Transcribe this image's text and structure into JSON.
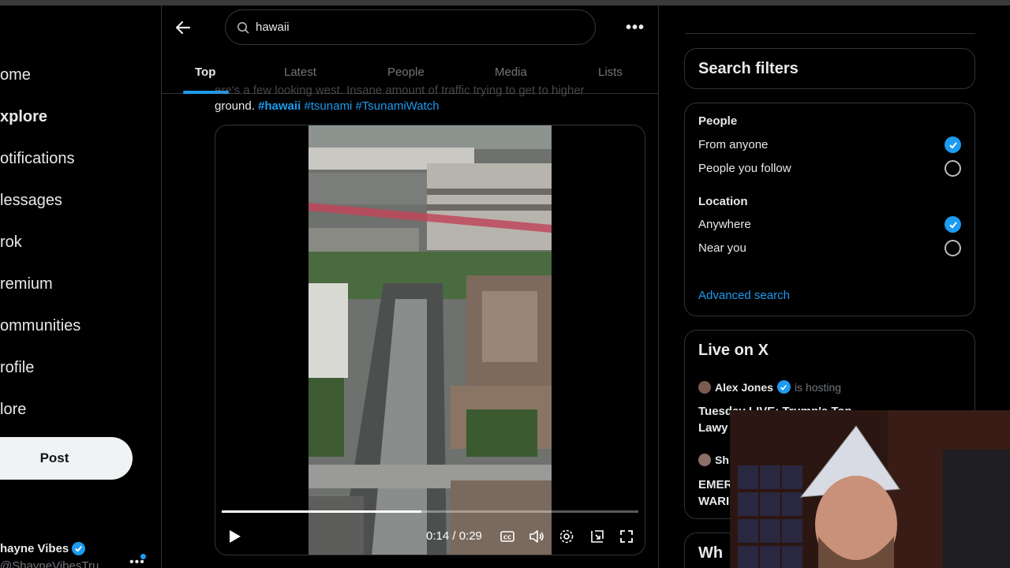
{
  "nav": {
    "items": [
      {
        "key": "home",
        "label": "ome"
      },
      {
        "key": "explore",
        "label": "xplore"
      },
      {
        "key": "notifications",
        "label": "otifications"
      },
      {
        "key": "messages",
        "label": "lessages"
      },
      {
        "key": "grok",
        "label": "rok"
      },
      {
        "key": "premium",
        "label": "remium"
      },
      {
        "key": "communities",
        "label": "ommunities"
      },
      {
        "key": "profile",
        "label": "rofile"
      },
      {
        "key": "more",
        "label": "lore"
      }
    ],
    "post_label": "Post",
    "account_name": "hayne Vibes",
    "account_handle": "@ShayneVibesTru"
  },
  "search": {
    "value": "hawaii"
  },
  "tabs": [
    {
      "label": "Top"
    },
    {
      "label": "Latest"
    },
    {
      "label": "People"
    },
    {
      "label": "Media"
    },
    {
      "label": "Lists"
    }
  ],
  "tweet": {
    "faded_text": "ere's a few looking west. Insane amount of traffic trying to get to higher",
    "text_prefix": "ground. ",
    "hashtags": [
      "#hawaii",
      "#tsunami",
      "#TsunamiWatch"
    ]
  },
  "video": {
    "time": "0:14 / 0:29",
    "progress": 0.48
  },
  "filters": {
    "title": "Search filters",
    "people_label": "People",
    "people_options": [
      {
        "label": "From anyone",
        "selected": true
      },
      {
        "label": "People you follow",
        "selected": false
      }
    ],
    "location_label": "Location",
    "location_options": [
      {
        "label": "Anywhere",
        "selected": true
      },
      {
        "label": "Near you",
        "selected": false
      }
    ],
    "advanced_label": "Advanced search"
  },
  "live": {
    "title": "Live on X",
    "entries": [
      {
        "host": "Alex Jones",
        "status": "is hosting",
        "title": "Tuesday LIVE: Trump's Top Lawy"
      },
      {
        "host": "Sh",
        "title": "EMER WARI"
      }
    ],
    "next_title": "Wh"
  },
  "colors": {
    "accent": "#1d9bf0",
    "background": "#000000",
    "border": "#2f3336",
    "muted": "#71767b"
  }
}
